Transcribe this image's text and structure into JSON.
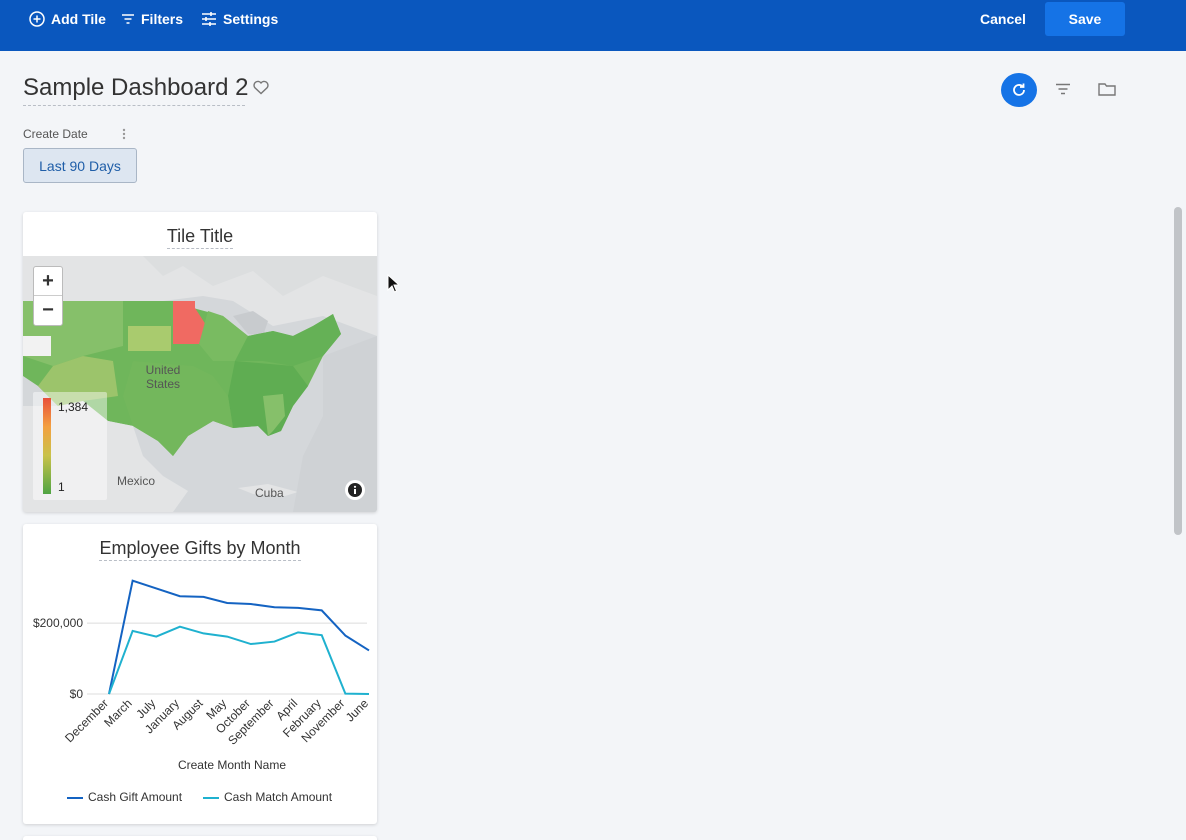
{
  "toolbar": {
    "add_tile": "Add Tile",
    "filters": "Filters",
    "settings": "Settings",
    "cancel": "Cancel",
    "save": "Save"
  },
  "dashboard": {
    "title": "Sample Dashboard 2"
  },
  "filter": {
    "label": "Create Date",
    "value": "Last 90 Days"
  },
  "map_tile": {
    "title": "Tile Title",
    "zoom_in": "+",
    "zoom_out": "−",
    "legend_max": "1,384",
    "legend_min": "1",
    "labels": {
      "us": "United States",
      "mexico": "Mexico",
      "cuba": "Cuba"
    }
  },
  "chart_tile": {
    "title": "Employee Gifts by Month"
  },
  "chart_data": {
    "type": "line",
    "title": "Employee Gifts by Month",
    "xlabel": "Create Month Name",
    "ylabel": "",
    "categories": [
      "December",
      "March",
      "July",
      "January",
      "August",
      "May",
      "October",
      "September",
      "April",
      "February",
      "November",
      "June"
    ],
    "y_ticks": [
      {
        "value": 0,
        "label": "$0"
      },
      {
        "value": 200000,
        "label": "$200,000"
      }
    ],
    "ylim": [
      0,
      350000
    ],
    "series": [
      {
        "name": "Cash Gift Amount",
        "color": "#1463c2",
        "values": [
          0,
          320000,
          298000,
          276000,
          274000,
          257000,
          254000,
          245000,
          243000,
          236000,
          165000,
          123000
        ]
      },
      {
        "name": "Cash Match Amount",
        "color": "#1fb1cf",
        "values": [
          0,
          178000,
          162000,
          190000,
          171000,
          162000,
          141000,
          148000,
          174000,
          166000,
          1000,
          0
        ]
      }
    ],
    "legend_position": "bottom"
  }
}
